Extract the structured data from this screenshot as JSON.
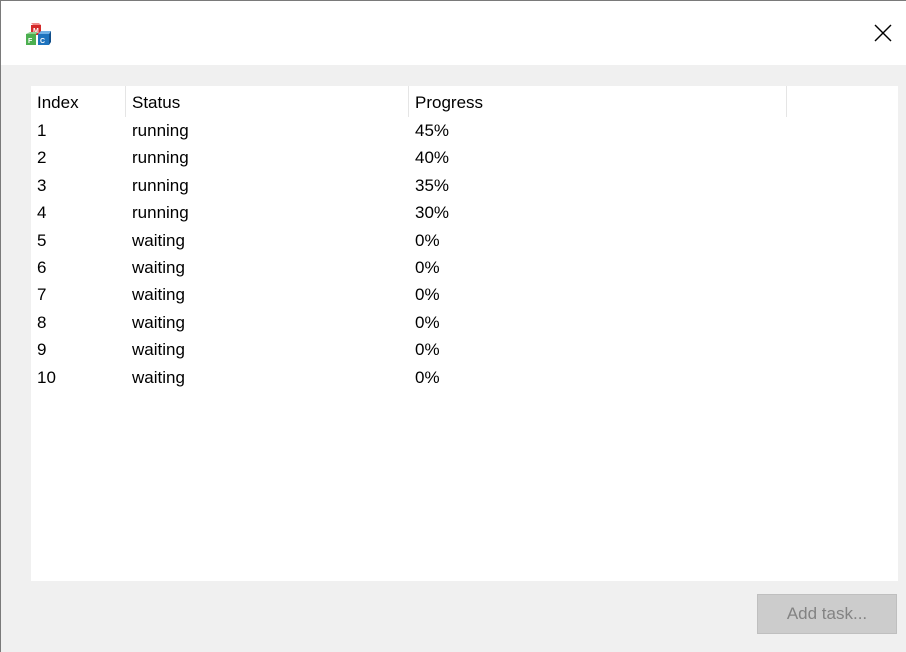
{
  "window": {
    "app_icon": "mfc-app-icon",
    "close_icon": "close-icon"
  },
  "list": {
    "columns": [
      "Index",
      "Status",
      "Progress"
    ],
    "rows": [
      {
        "index": "1",
        "status": "running",
        "progress": "45%"
      },
      {
        "index": "2",
        "status": "running",
        "progress": "40%"
      },
      {
        "index": "3",
        "status": "running",
        "progress": "35%"
      },
      {
        "index": "4",
        "status": "running",
        "progress": "30%"
      },
      {
        "index": "5",
        "status": "waiting",
        "progress": "0%"
      },
      {
        "index": "6",
        "status": "waiting",
        "progress": "0%"
      },
      {
        "index": "7",
        "status": "waiting",
        "progress": "0%"
      },
      {
        "index": "8",
        "status": "waiting",
        "progress": "0%"
      },
      {
        "index": "9",
        "status": "waiting",
        "progress": "0%"
      },
      {
        "index": "10",
        "status": "waiting",
        "progress": "0%"
      }
    ]
  },
  "buttons": {
    "add_task_label": "Add task...",
    "add_task_enabled": false
  },
  "colors": {
    "dialog_background": "#f0f0f0",
    "list_background": "#ffffff",
    "disabled_button_background": "#cccccc",
    "disabled_button_text": "#838383"
  }
}
